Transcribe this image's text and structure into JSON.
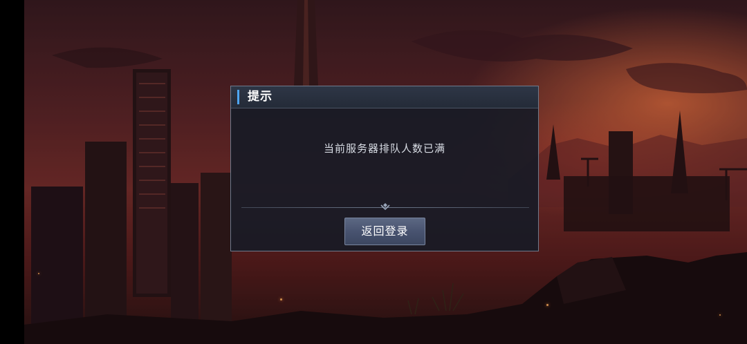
{
  "dialog": {
    "title": "提示",
    "message": "当前服务器排队人数已满",
    "button_label": "返回登录"
  },
  "icons": {
    "divider": "diamond-chevron-icon"
  },
  "colors": {
    "accent": "#4ea6f5",
    "dialog_bg": "#161b26",
    "button_bg": "#485370",
    "sky_glow": "#e87040"
  }
}
